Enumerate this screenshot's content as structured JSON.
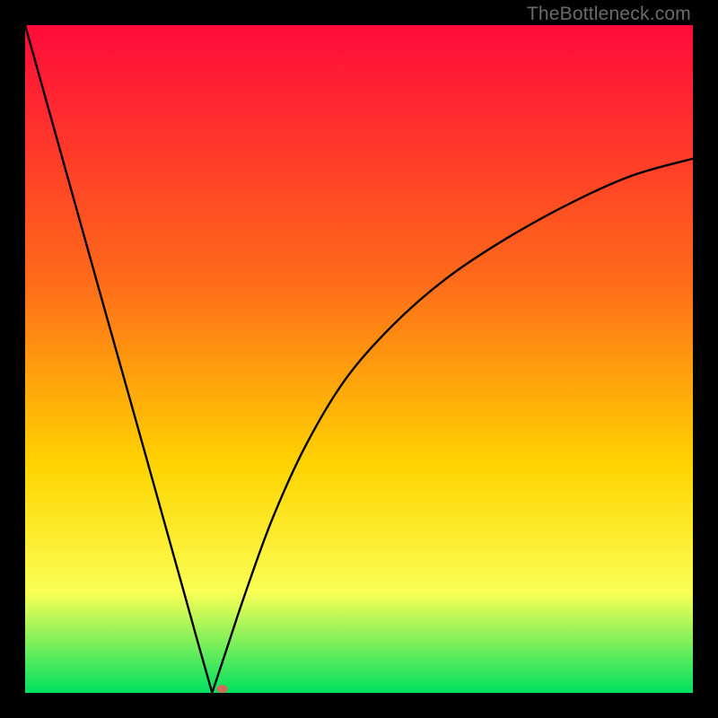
{
  "watermark": "TheBottleneck.com",
  "colors": {
    "top": "#ff0a3a",
    "mid1": "#ff6a1a",
    "mid2": "#ffd400",
    "mid3": "#faff55",
    "bottom": "#00e060",
    "curve": "#000000",
    "marker": "#d46a5a",
    "frame": "#000000"
  },
  "chart_data": {
    "type": "line",
    "title": "",
    "xlabel": "",
    "ylabel": "",
    "xlim": [
      0,
      100
    ],
    "ylim": [
      0,
      100
    ],
    "min_x": 28,
    "series": [
      {
        "name": "left-branch",
        "x": [
          0,
          4,
          8,
          12,
          16,
          20,
          24,
          26,
          27.5,
          28
        ],
        "values": [
          100,
          85.7,
          71.4,
          57.1,
          42.9,
          28.6,
          14.3,
          7.1,
          1.8,
          0
        ]
      },
      {
        "name": "right-branch",
        "x": [
          28,
          30,
          33,
          37,
          42,
          48,
          55,
          63,
          72,
          82,
          91,
          100
        ],
        "values": [
          0,
          6,
          15,
          26,
          37,
          47,
          55,
          62,
          68,
          73.5,
          77.5,
          80
        ]
      }
    ],
    "marker": {
      "x": 29.5,
      "y": 0.6
    }
  }
}
